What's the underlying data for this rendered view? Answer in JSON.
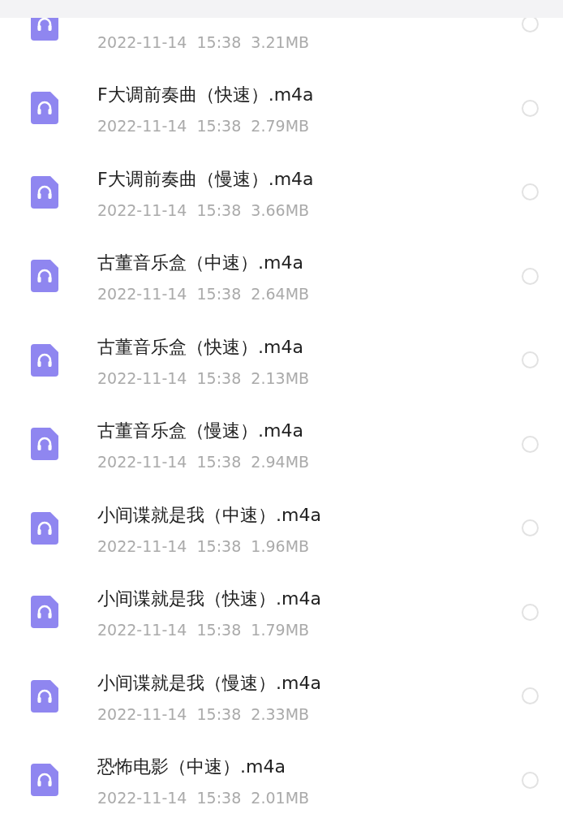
{
  "files": [
    {
      "meta": "2022-11-14  15:38  3.21MB",
      "selected": false
    },
    {
      "name": "F大调前奏曲（快速）.m4a",
      "meta": "2022-11-14  15:38  2.79MB",
      "selected": false
    },
    {
      "name": "F大调前奏曲（慢速）.m4a",
      "meta": "2022-11-14  15:38  3.66MB",
      "selected": false
    },
    {
      "name": "古董音乐盒（中速）.m4a",
      "meta": "2022-11-14  15:38  2.64MB",
      "selected": false
    },
    {
      "name": "古董音乐盒（快速）.m4a",
      "meta": "2022-11-14  15:38  2.13MB",
      "selected": false
    },
    {
      "name": "古董音乐盒（慢速）.m4a",
      "meta": "2022-11-14  15:38  2.94MB",
      "selected": false
    },
    {
      "name": "小间谍就是我（中速）.m4a",
      "meta": "2022-11-14  15:38  1.96MB",
      "selected": false
    },
    {
      "name": "小间谍就是我（快速）.m4a",
      "meta": "2022-11-14  15:38  1.79MB",
      "selected": false
    },
    {
      "name": "小间谍就是我（慢速）.m4a",
      "meta": "2022-11-14  15:38  2.33MB",
      "selected": false
    },
    {
      "name": "恐怖电影（中速）.m4a",
      "meta": "2022-11-14  15:38  2.01MB",
      "selected": false
    }
  ]
}
